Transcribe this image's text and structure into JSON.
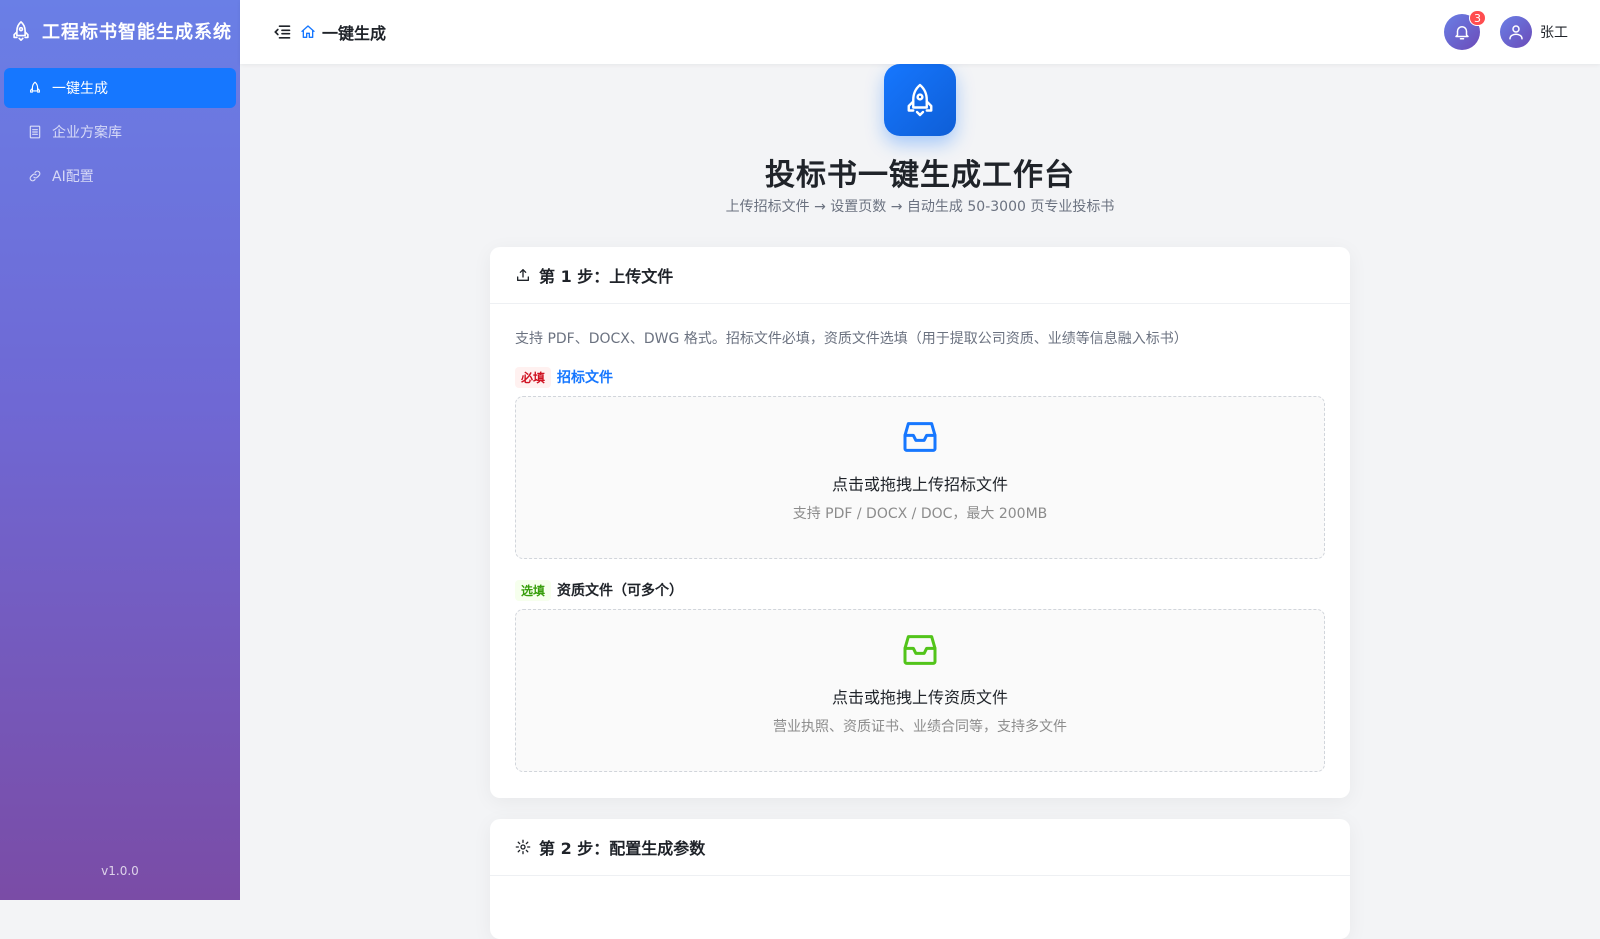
{
  "app": {
    "title": "工程标书智能生成系统",
    "version": "v1.0.0"
  },
  "sidebar": {
    "items": [
      {
        "label": "一键生成",
        "icon": "rocket-icon",
        "active": true
      },
      {
        "label": "企业方案库",
        "icon": "file-icon",
        "active": false
      },
      {
        "label": "AI配置",
        "icon": "link-icon",
        "active": false
      }
    ]
  },
  "header": {
    "breadcrumb": "一键生成",
    "notification_count": "3",
    "user_name": "张工"
  },
  "hero": {
    "title": "投标书一键生成工作台",
    "subtitle": "上传招标文件 → 设置页数 → 自动生成 50-3000 页专业投标书"
  },
  "step1": {
    "title": "第 1 步：上传文件",
    "description": "支持 PDF、DOCX、DWG 格式。招标文件必填，资质文件选填（用于提取公司资质、业绩等信息融入标书）",
    "tender": {
      "tag": "必填",
      "label": "招标文件",
      "upload_title": "点击或拖拽上传招标文件",
      "upload_hint": "支持 PDF / DOCX / DOC，最大 200MB"
    },
    "qualification": {
      "tag": "选填",
      "label": "资质文件（可多个）",
      "upload_title": "点击或拖拽上传资质文件",
      "upload_hint": "营业执照、资质证书、业绩合同等，支持多文件"
    }
  },
  "step2": {
    "title": "第 2 步：配置生成参数"
  },
  "colors": {
    "primary": "#1677ff",
    "success": "#52c41a",
    "danger": "#ff4d4f"
  }
}
